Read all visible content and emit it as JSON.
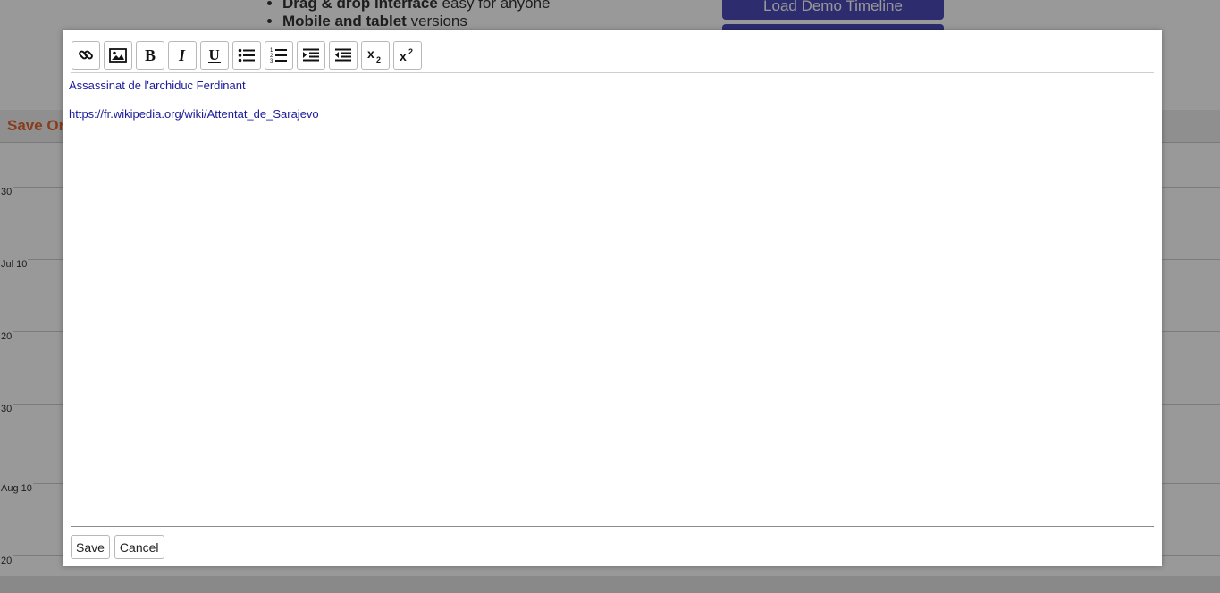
{
  "background": {
    "features": [
      {
        "bold": "Drag & drop interface",
        "rest": " easy for anyone"
      },
      {
        "bold": "Mobile and tablet",
        "rest": " versions"
      }
    ],
    "demo_button_label": "Load Demo Timeline",
    "save_bar_label": "Save Or",
    "ticks": [
      "30",
      "Jul 10",
      "20",
      "30",
      "Aug 10",
      "20"
    ]
  },
  "toolbar": {
    "buttons": [
      {
        "name": "link-icon"
      },
      {
        "name": "image-icon"
      },
      {
        "name": "bold-icon"
      },
      {
        "name": "italic-icon"
      },
      {
        "name": "underline-icon"
      },
      {
        "name": "bullet-list-icon"
      },
      {
        "name": "numbered-list-icon"
      },
      {
        "name": "indent-icon"
      },
      {
        "name": "outdent-icon"
      },
      {
        "name": "subscript-icon"
      },
      {
        "name": "superscript-icon"
      }
    ]
  },
  "editor": {
    "line1": "Assassinat de l'archiduc Ferdinant",
    "line2": "https://fr.wikipedia.org/wiki/Attentat_de_Sarajevo",
    "text_color": "#1a1a9a"
  },
  "footer": {
    "save_label": "Save",
    "cancel_label": "Cancel"
  }
}
